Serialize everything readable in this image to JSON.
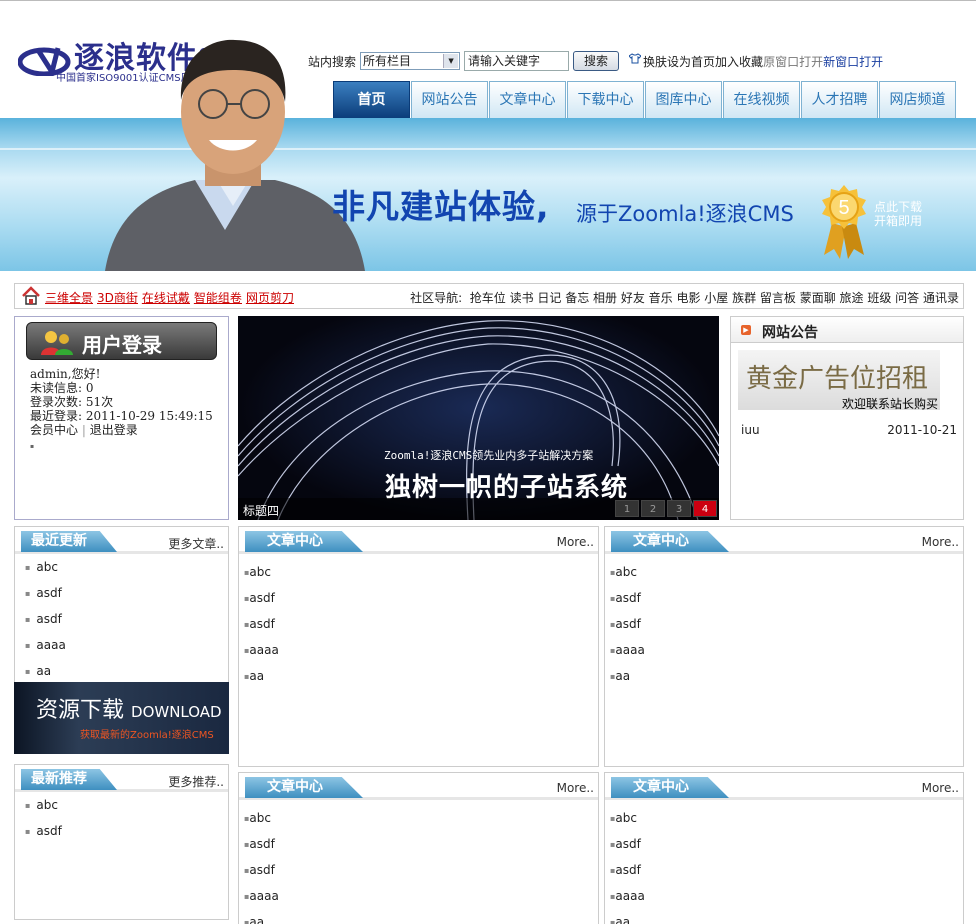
{
  "header": {
    "logo_name": "逐浪软件",
    "logo_reg": "®",
    "logo_tagline": "中国首家ISO9001认证CMS厂商",
    "search_label": "站内搜索",
    "search_scope": "所有栏目",
    "search_placeholder": "请输入关键字",
    "search_button": "搜索",
    "links": [
      "换肤",
      "设为首页",
      "加入收藏",
      "原窗口打开",
      "新窗口打开"
    ]
  },
  "nav": {
    "tabs": [
      "首页",
      "网站公告",
      "文章中心",
      "下载中心",
      "图库中心",
      "在线视频",
      "人才招聘",
      "网店频道"
    ]
  },
  "banner": {
    "slogan_main": "非凡建站体验,",
    "slogan_sub": "源于Zoomla!逐浪CMS",
    "medal_number": "5",
    "download_line1": "点此下载",
    "download_line2": "开箱即用"
  },
  "quickbar": {
    "links": [
      "三维全景",
      "3D商街",
      "在线试戴",
      "智能组卷",
      "网页剪刀"
    ],
    "community_label": "社区导航:",
    "community_items": "抢车位 读书 日记 备忘 相册 好友 音乐 电影 小屋 族群 留言板 蒙面聊 旅途 班级 问答 通讯录"
  },
  "login": {
    "title": "用户登录",
    "greeting": "admin,您好!",
    "unread": "未读信息: 0",
    "login_count": "登录次数: 51次",
    "last_login": "最近登录: 2011-10-29 15:49:15",
    "member_center": "会员中心",
    "separator": "|",
    "logout": "退出登录"
  },
  "slideshow": {
    "subtitle": "Zoomla!逐浪CMS领先业内多子站解决方案",
    "headline": "独树一帜的子站系统",
    "caption": "标题四",
    "pages": [
      "1",
      "2",
      "3",
      "4"
    ],
    "active_page": 4
  },
  "notice": {
    "title": "网站公告",
    "ad_main": "黄金广告位招租",
    "ad_sub": "欢迎联系站长购买",
    "items": [
      {
        "title": "iuu",
        "date": "2011-10-21"
      }
    ]
  },
  "recent": {
    "title": "最近更新",
    "more": "更多文章..",
    "items": [
      "abc",
      "asdf",
      "asdf",
      "aaaa",
      "aa"
    ]
  },
  "download_banner": {
    "title": "资源下载",
    "title_en": "DOWNLOAD",
    "subtitle": "获取最新的Zoomla!逐浪CMS"
  },
  "recommend": {
    "title": "最新推荐",
    "more": "更多推荐..",
    "items": [
      "abc",
      "asdf"
    ]
  },
  "article_panels": [
    {
      "title": "文章中心",
      "more": "More..",
      "items": [
        "abc",
        "asdf",
        "asdf",
        "aaaa",
        "aa"
      ]
    },
    {
      "title": "文章中心",
      "more": "More..",
      "items": [
        "abc",
        "asdf",
        "asdf",
        "aaaa",
        "aa"
      ]
    },
    {
      "title": "文章中心",
      "more": "More..",
      "items": [
        "abc",
        "asdf",
        "asdf",
        "aaaa",
        "aa"
      ]
    },
    {
      "title": "文章中心",
      "more": "More..",
      "items": [
        "abc",
        "asdf",
        "asdf",
        "aaaa",
        "aa"
      ]
    }
  ]
}
